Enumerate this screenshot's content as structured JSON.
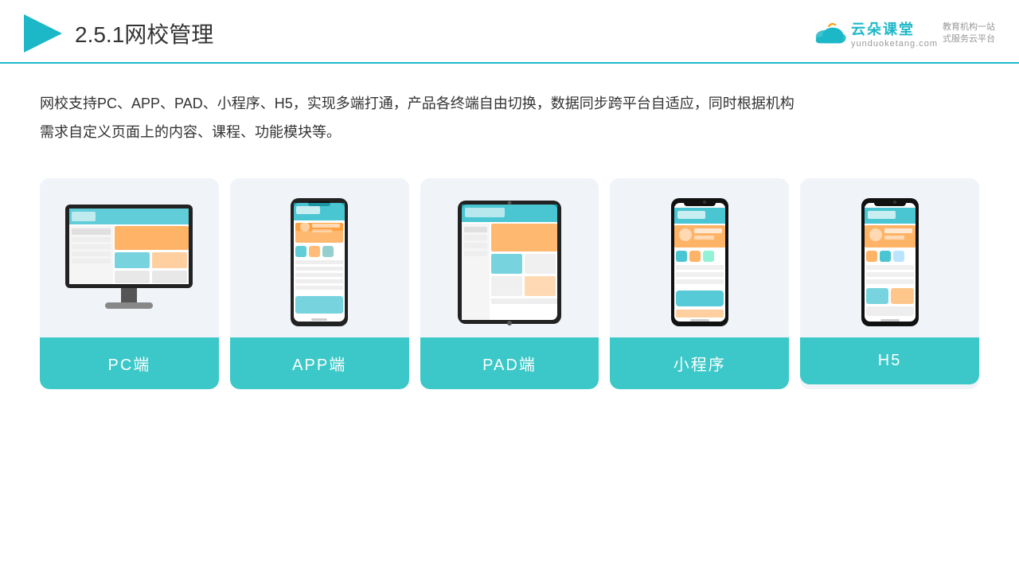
{
  "header": {
    "title_number": "2.5.1",
    "title_text": "网校管理",
    "logo_text": "云朵课堂",
    "logo_url": "yunduoketang.com",
    "logo_tagline": "教育机构一站\n式服务云平台"
  },
  "description": "网校支持PC、APP、PAD、小程序、H5，实现多端打通，产品各终端自由切换，数据同步跨平台自适应，同时根据机构\n需求自定义页面上的内容、课程、功能模块等。",
  "cards": [
    {
      "id": "pc",
      "label": "PC端"
    },
    {
      "id": "app",
      "label": "APP端"
    },
    {
      "id": "pad",
      "label": "PAD端"
    },
    {
      "id": "miniprogram",
      "label": "小程序"
    },
    {
      "id": "h5",
      "label": "H5"
    }
  ],
  "accent_color": "#3cc8c8"
}
